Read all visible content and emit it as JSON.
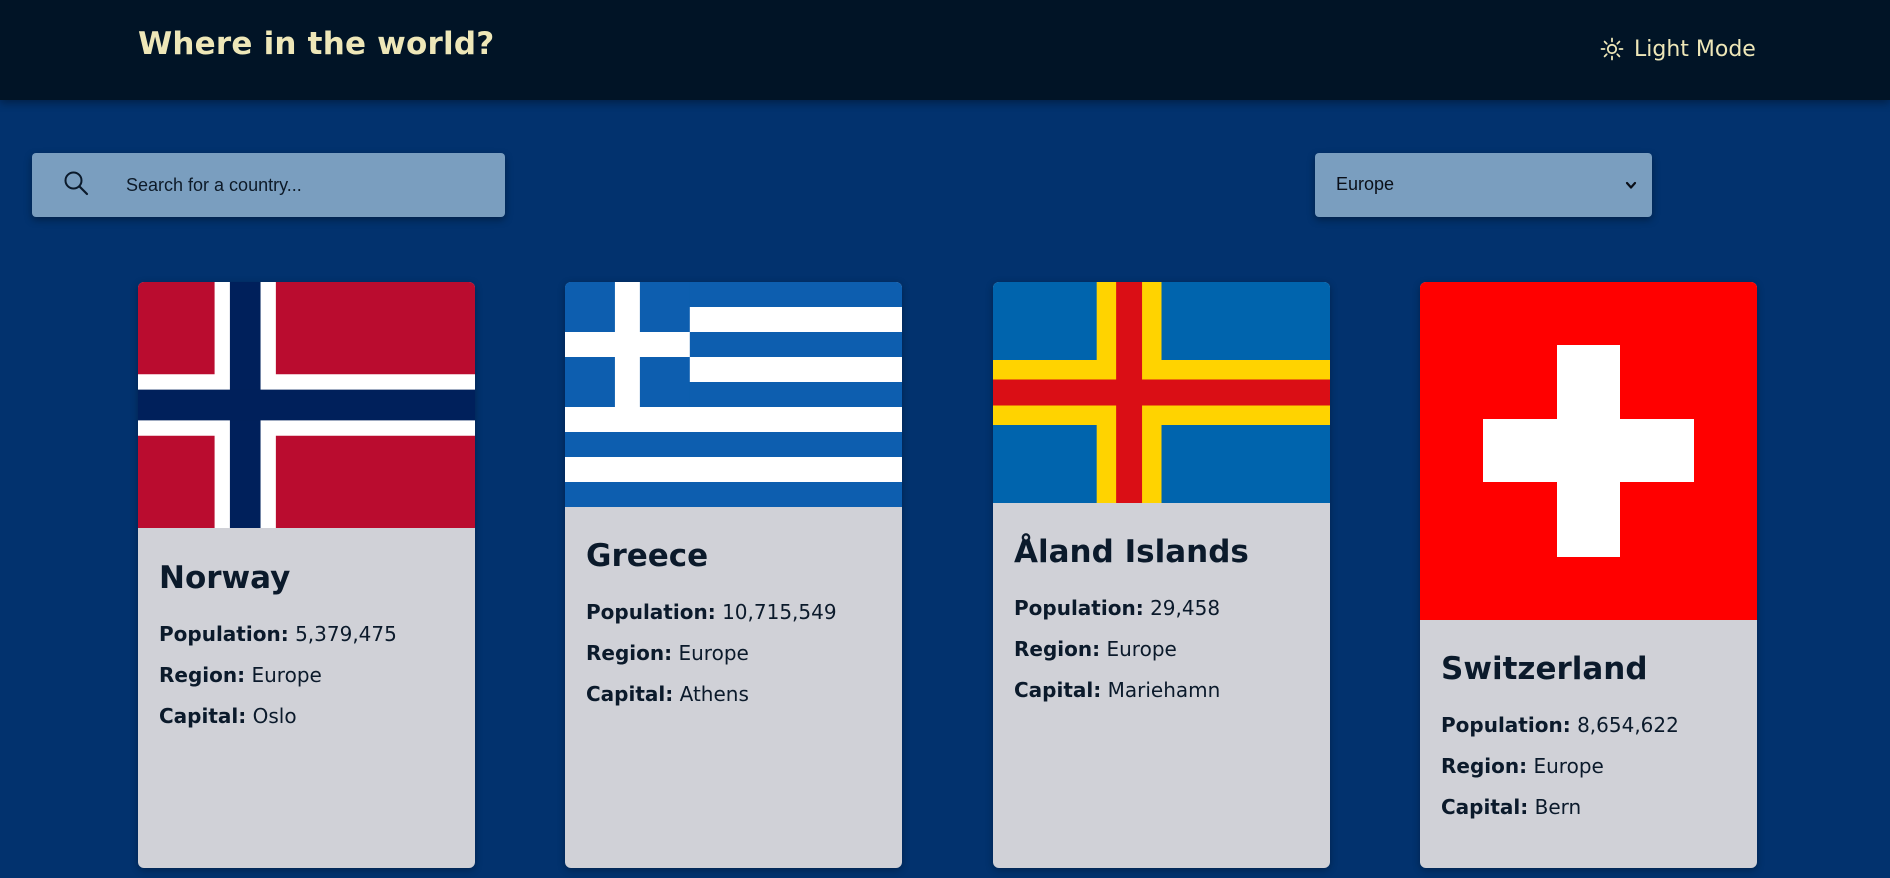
{
  "header": {
    "title": "Where in the world?",
    "mode_label": "Light Mode",
    "mode_icon": "sun-icon"
  },
  "search": {
    "placeholder": "Search for a country...",
    "value": "",
    "icon": "search-icon"
  },
  "filter": {
    "selected": "Europe",
    "icon": "chevron-down-icon"
  },
  "labels": {
    "population": "Population:",
    "region": "Region:",
    "capital": "Capital:"
  },
  "countries": [
    {
      "name": "Norway",
      "population": "5,379,475",
      "region": "Europe",
      "capital": "Oslo"
    },
    {
      "name": "Greece",
      "population": "10,715,549",
      "region": "Europe",
      "capital": "Athens"
    },
    {
      "name": "Åland Islands",
      "population": "29,458",
      "region": "Europe",
      "capital": "Mariehamn"
    },
    {
      "name": "Switzerland",
      "population": "8,654,622",
      "region": "Europe",
      "capital": "Bern"
    }
  ],
  "colors": {
    "background": "#02326e",
    "header": "#011426",
    "accent_text": "#eee7b8",
    "input": "#7a9ebf",
    "card": "#d0d1d7"
  }
}
